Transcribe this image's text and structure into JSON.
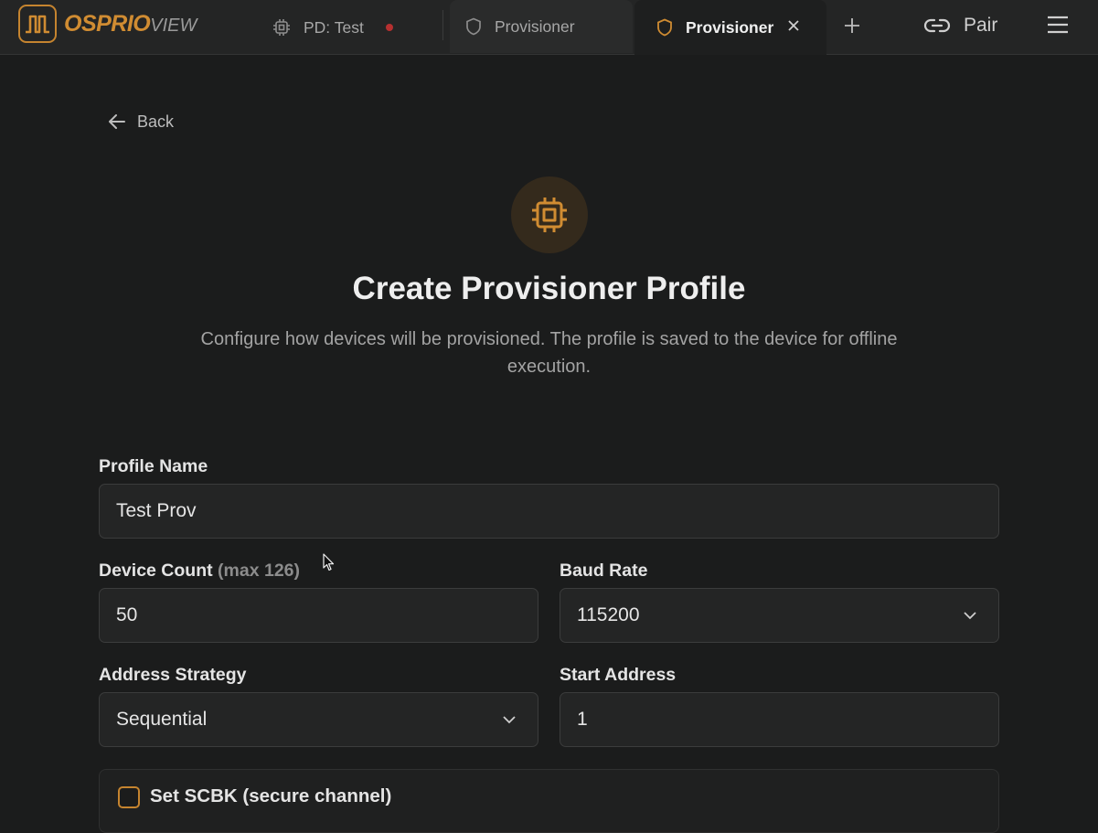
{
  "app": {
    "logo_text_primary": "OSPRIO",
    "logo_text_secondary": "VIEW",
    "brand_color": "#c5842f"
  },
  "tabs": [
    {
      "label": "PD: Test",
      "icon": "chip-icon",
      "status": "disconnected"
    },
    {
      "label": "Provisioner",
      "icon": "shield-icon"
    },
    {
      "label": "Provisioner",
      "icon": "shield-icon",
      "active": true
    }
  ],
  "toolbar": {
    "pair_label": "Pair"
  },
  "nav": {
    "back_label": "Back"
  },
  "page": {
    "title": "Create Provisioner Profile",
    "description": "Configure how devices will be provisioned. The profile is saved to the device for offline execution."
  },
  "form": {
    "profile_name": {
      "label": "Profile Name",
      "value": "Test Prov"
    },
    "device_count": {
      "label": "Device Count",
      "hint": "(max 126)",
      "value": "50"
    },
    "baud_rate": {
      "label": "Baud Rate",
      "value": "115200"
    },
    "address_strategy": {
      "label": "Address Strategy",
      "value": "Sequential"
    },
    "start_address": {
      "label": "Start Address",
      "value": "1"
    },
    "scbk": {
      "label": "Set SCBK (secure channel)",
      "checked": false
    }
  }
}
